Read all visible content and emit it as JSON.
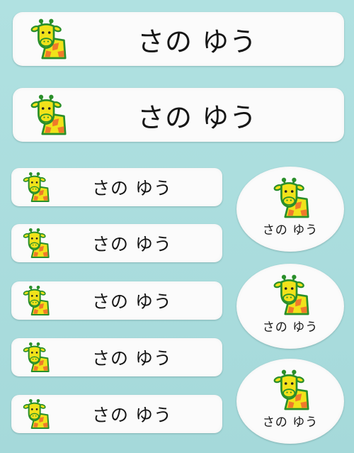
{
  "sticker_text": "さの ゆう",
  "icon": "giraffe-icon",
  "colors": {
    "background": "#a9dcdc",
    "label": "#fbfbfb",
    "giraffe_yellow": "#f1e21a",
    "giraffe_outline": "#2a8f2a",
    "giraffe_spots": "#f07a2a"
  }
}
